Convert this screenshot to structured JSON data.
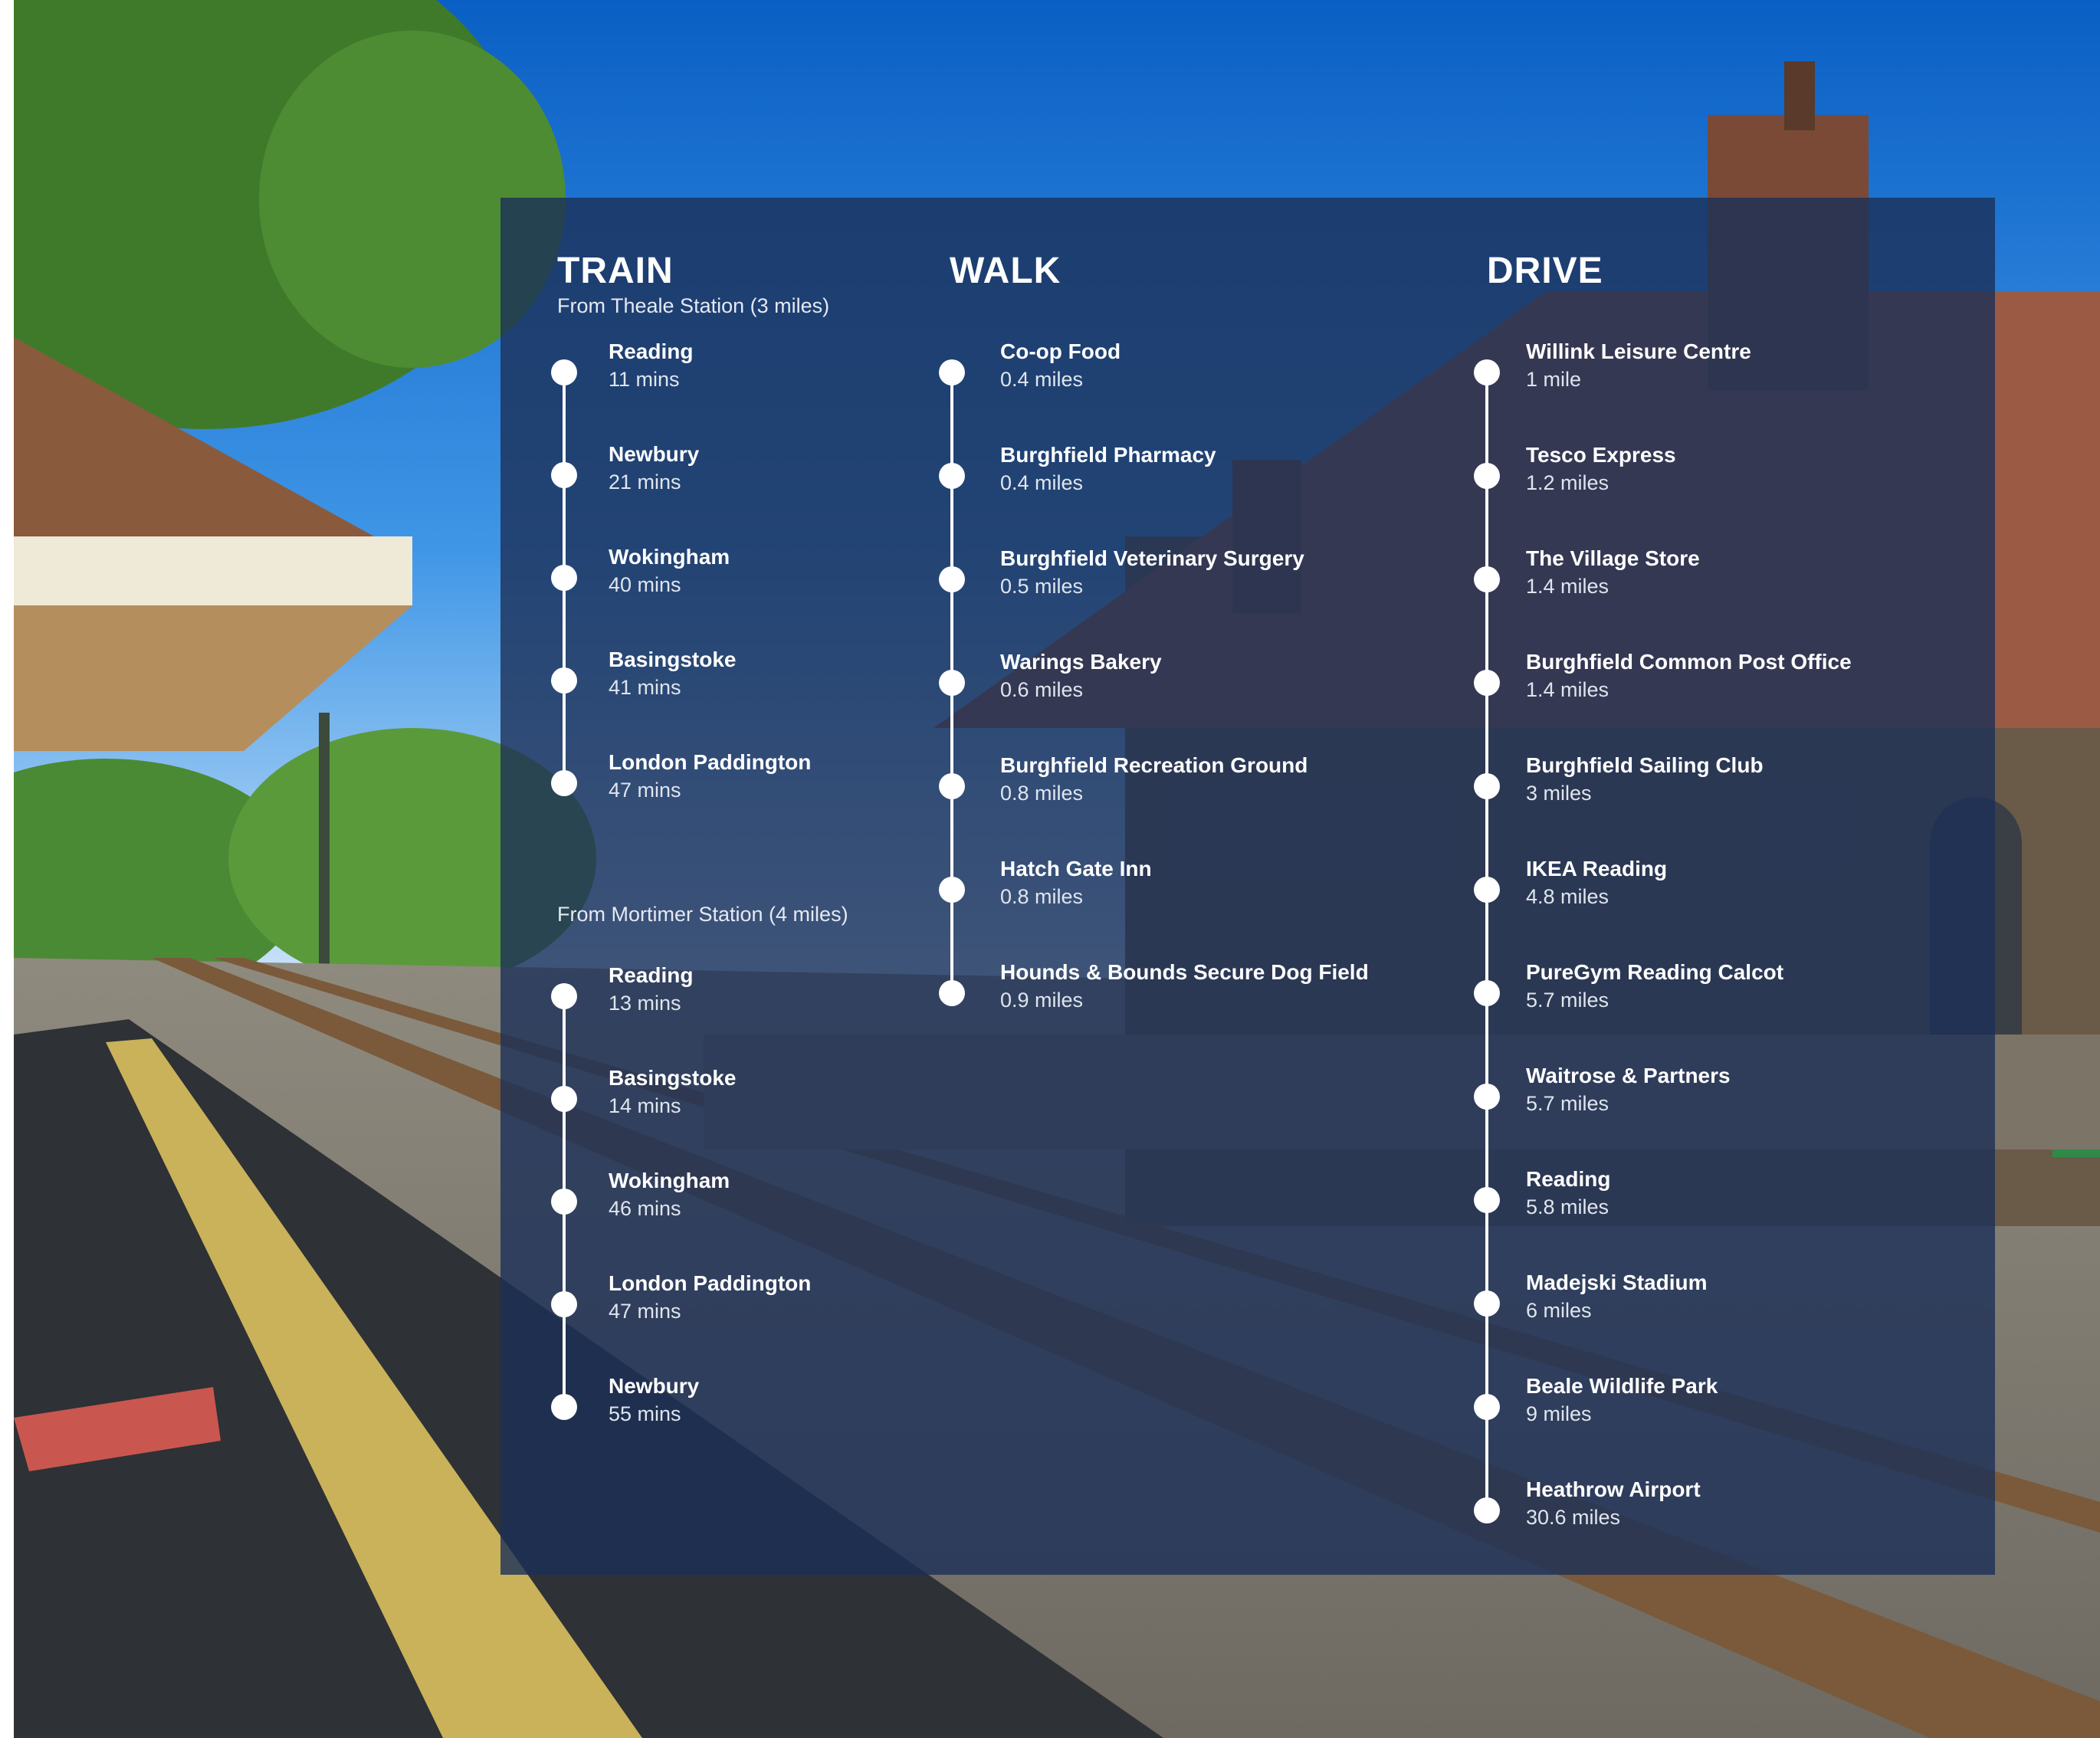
{
  "colors": {
    "panel": "#1b3058",
    "accent": "#ffffff",
    "sky": "#0a62c6"
  },
  "train": {
    "title": "TRAIN",
    "groups": [
      {
        "label": "From Theale Station (3 miles)",
        "items": [
          {
            "name": "Reading",
            "value": "11 mins"
          },
          {
            "name": "Newbury",
            "value": "21 mins"
          },
          {
            "name": "Wokingham",
            "value": "40 mins"
          },
          {
            "name": "Basingstoke",
            "value": "41 mins"
          },
          {
            "name": "London Paddington",
            "value": "47 mins"
          }
        ]
      },
      {
        "label": "From Mortimer Station (4 miles)",
        "items": [
          {
            "name": "Reading",
            "value": "13 mins"
          },
          {
            "name": "Basingstoke",
            "value": "14 mins"
          },
          {
            "name": "Wokingham",
            "value": "46 mins"
          },
          {
            "name": "London Paddington",
            "value": "47 mins"
          },
          {
            "name": "Newbury",
            "value": "55 mins"
          }
        ]
      }
    ]
  },
  "walk": {
    "title": "WALK",
    "items": [
      {
        "name": "Co-op Food",
        "value": "0.4 miles"
      },
      {
        "name": "Burghfield Pharmacy",
        "value": "0.4 miles"
      },
      {
        "name": "Burghfield Veterinary Surgery",
        "value": "0.5 miles"
      },
      {
        "name": "Warings Bakery",
        "value": "0.6 miles"
      },
      {
        "name": "Burghfield Recreation Ground",
        "value": "0.8 miles"
      },
      {
        "name": "Hatch Gate Inn",
        "value": "0.8 miles"
      },
      {
        "name": "Hounds & Bounds Secure Dog Field",
        "value": "0.9 miles"
      }
    ]
  },
  "drive": {
    "title": "DRIVE",
    "items": [
      {
        "name": "Willink Leisure Centre",
        "value": "1 mile"
      },
      {
        "name": "Tesco Express",
        "value": "1.2 miles"
      },
      {
        "name": "The Village Store",
        "value": "1.4 miles"
      },
      {
        "name": "Burghfield Common Post Office",
        "value": "1.4 miles"
      },
      {
        "name": "Burghfield Sailing Club",
        "value": "3 miles"
      },
      {
        "name": "IKEA Reading",
        "value": "4.8 miles"
      },
      {
        "name": "PureGym Reading Calcot",
        "value": "5.7 miles"
      },
      {
        "name": "Waitrose & Partners",
        "value": "5.7 miles"
      },
      {
        "name": "Reading",
        "value": "5.8 miles"
      },
      {
        "name": "Madejski Stadium",
        "value": "6 miles"
      },
      {
        "name": "Beale Wildlife Park",
        "value": "9 miles"
      },
      {
        "name": "Heathrow Airport",
        "value": "30.6 miles"
      }
    ]
  }
}
